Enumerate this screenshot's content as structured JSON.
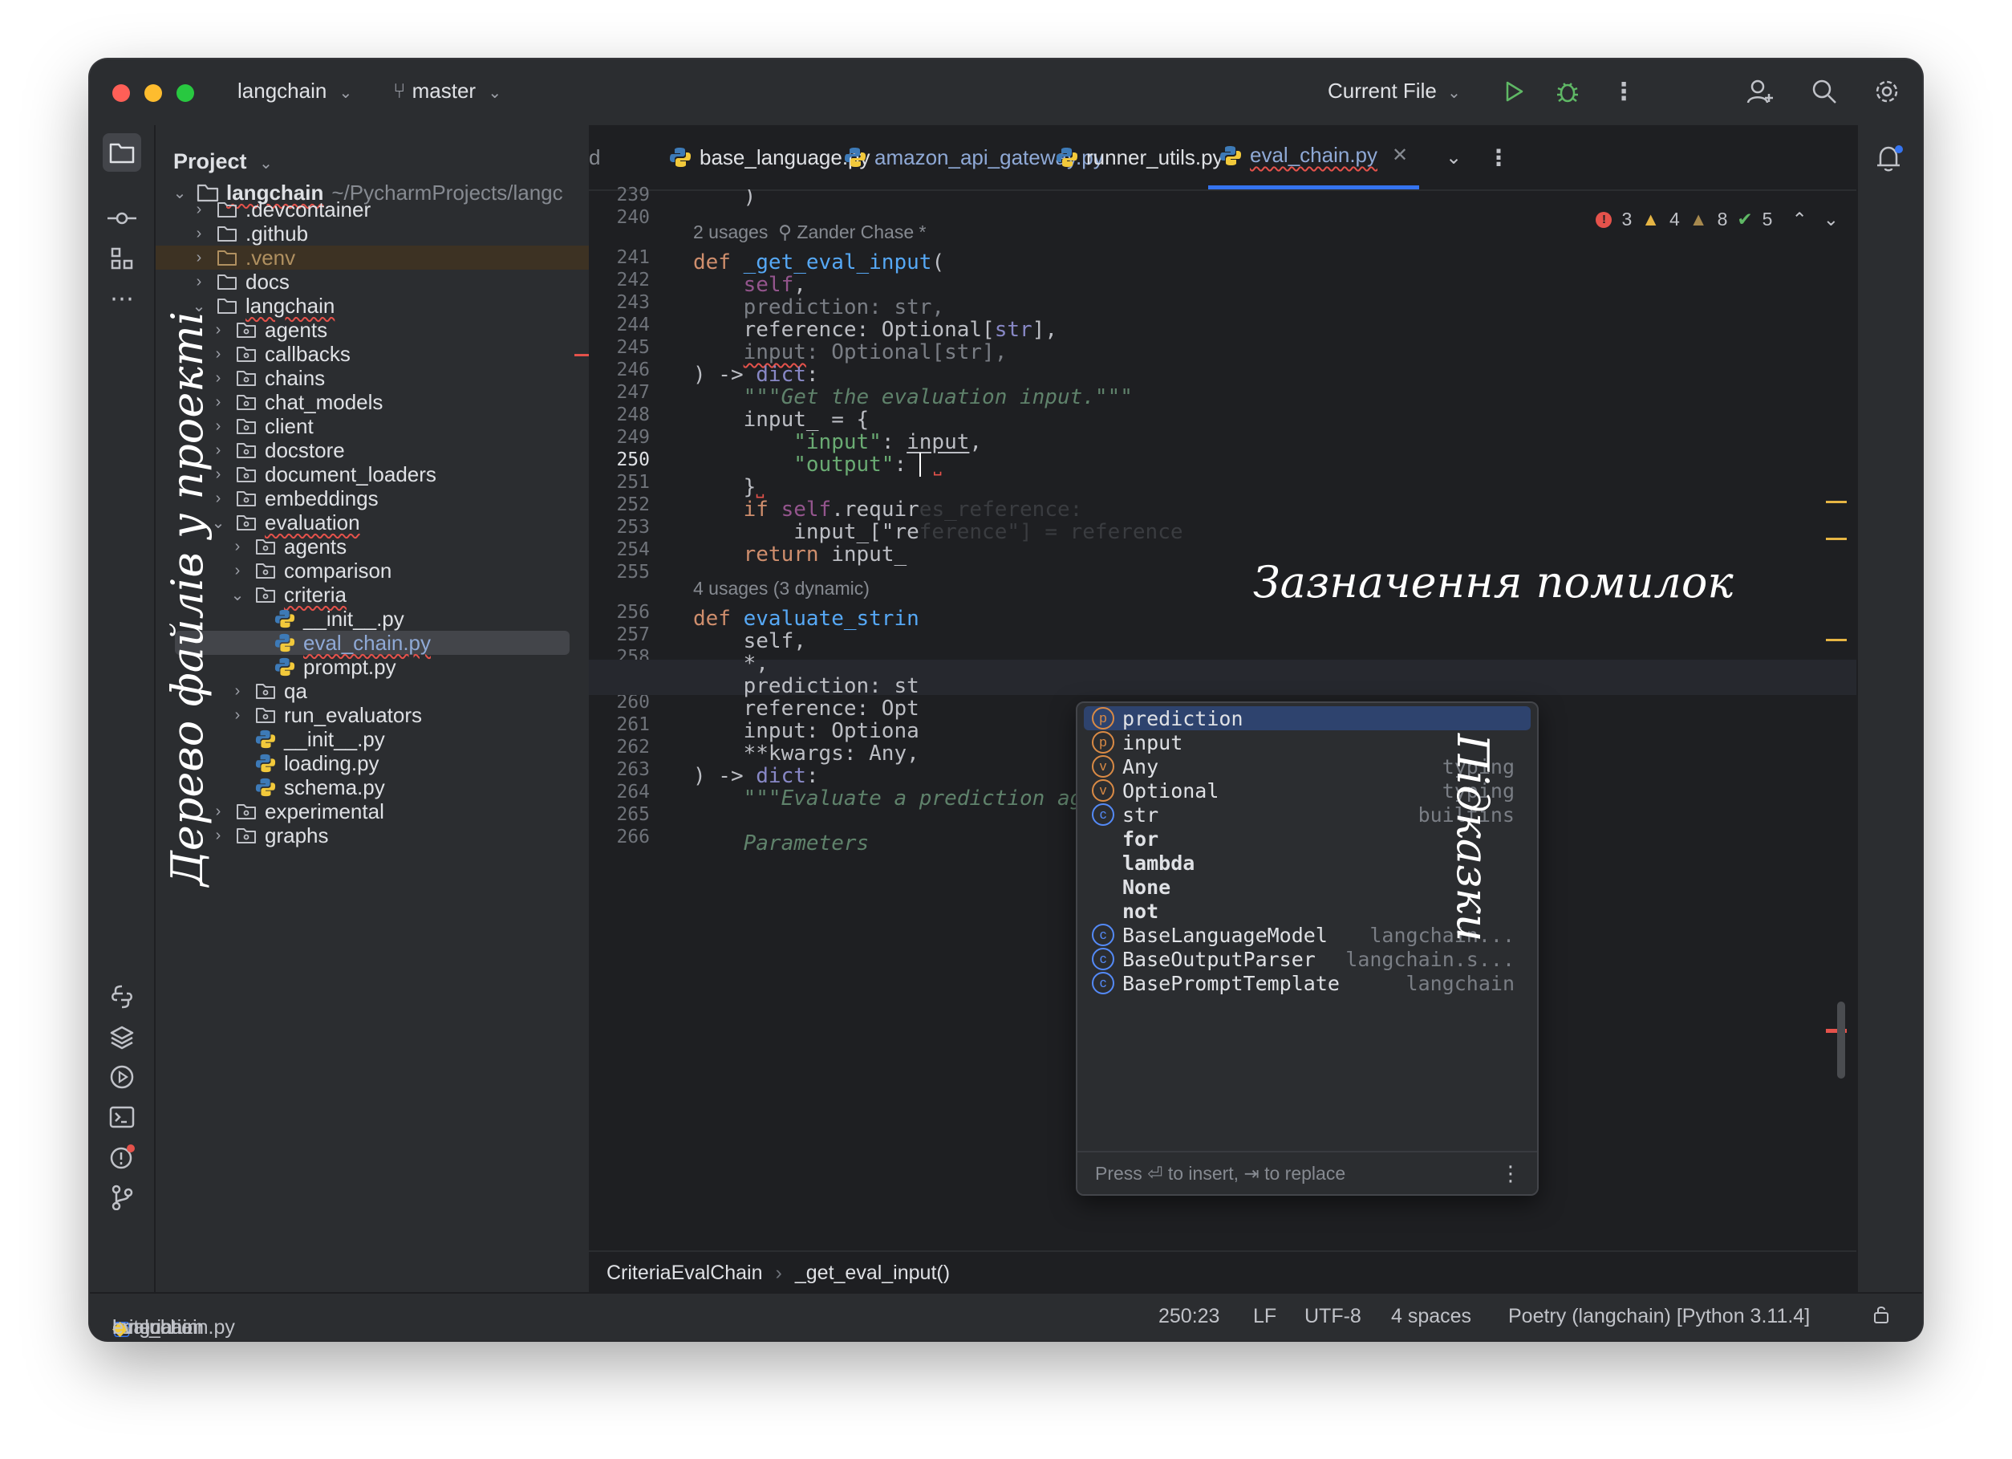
{
  "titlebar": {
    "project": "langchain",
    "branch": "master",
    "run_config": "Current File"
  },
  "project_panel": {
    "title": "Project",
    "root": {
      "name": "langchain",
      "path": "~/PycharmProjects/langc"
    },
    "items": [
      {
        "label": ".devcontainer"
      },
      {
        "label": ".github"
      },
      {
        "label": ".venv"
      },
      {
        "label": "docs"
      },
      {
        "label": "langchain"
      },
      {
        "label": "agents"
      },
      {
        "label": "callbacks"
      },
      {
        "label": "chains"
      },
      {
        "label": "chat_models"
      },
      {
        "label": "client"
      },
      {
        "label": "docstore"
      },
      {
        "label": "document_loaders"
      },
      {
        "label": "embeddings"
      },
      {
        "label": "evaluation"
      },
      {
        "label": "agents"
      },
      {
        "label": "comparison"
      },
      {
        "label": "criteria"
      },
      {
        "label": "__init__.py"
      },
      {
        "label": "eval_chain.py"
      },
      {
        "label": "prompt.py"
      },
      {
        "label": "qa"
      },
      {
        "label": "run_evaluators"
      },
      {
        "label": "__init__.py"
      },
      {
        "label": "loading.py"
      },
      {
        "label": "schema.py"
      },
      {
        "label": "experimental"
      },
      {
        "label": "graphs"
      }
    ]
  },
  "tabs": [
    {
      "label": "d"
    },
    {
      "label": "base_language.py"
    },
    {
      "label": "amazon_api_gateway.py"
    },
    {
      "label": "runner_utils.py"
    },
    {
      "label": "eval_chain.py"
    }
  ],
  "inspections": {
    "errors": "3",
    "warnings": "4",
    "weak": "8",
    "ok": "5"
  },
  "line_numbers": [
    "239",
    "240",
    "241",
    "242",
    "243",
    "244",
    "245",
    "246",
    "247",
    "248",
    "249",
    "250",
    "251",
    "252",
    "253",
    "254",
    "255",
    "256",
    "257",
    "258",
    "259",
    "260",
    "261",
    "262",
    "263",
    "264",
    "265",
    "266"
  ],
  "inlay": {
    "usages1": "2 usages",
    "author1": "Zander Chase *",
    "usages2": "4 usages (3 dynamic)"
  },
  "code": {
    "l239": "    )",
    "def1": "def",
    "fn1": "_get_eval_input",
    "paren": "(",
    "self": "self",
    "comma": ",",
    "l243": "prediction: str,",
    "l244a": "reference: Optional[",
    "l244b": "str",
    "l244c": "],",
    "l245a": "input",
    "l245b": ": Optional[str],",
    "l246a": ") -> ",
    "l246b": "dict",
    "l246c": ":",
    "l247": "\"\"\"Get the evaluation input.\"\"\"",
    "l248": "input_ = {",
    "l249a": "\"input\"",
    "l249b": ": ",
    "l249c": "input",
    "l249d": ",",
    "l250a": "\"output\"",
    "l250b": ": ",
    "l251": "}",
    "l252a": "if ",
    "l252b": "self",
    "l252c": ".requir",
    "l252ghost": "es_reference:",
    "l253a": "input_[\"re",
    "l253ghost": "ference\"] = reference",
    "l254a": "return ",
    "l254b": "input_",
    "fn2": "evaluate_strin",
    "l257": "self,",
    "l258": "*,",
    "l259": "prediction: st",
    "l260": "reference: Opt",
    "l261": "input: Optiona",
    "l262": "**kwargs: Any,",
    "l263b": "dict",
    "l264": "\"\"\"Evaluate a prediction against the criteria.",
    "l266": "Parameters"
  },
  "completion": {
    "items": [
      {
        "icon": "p",
        "label": "prediction",
        "source": ""
      },
      {
        "icon": "p",
        "label": "input",
        "source": ""
      },
      {
        "icon": "v",
        "label": "Any",
        "source": "typing"
      },
      {
        "icon": "v",
        "label": "Optional",
        "source": "typing"
      },
      {
        "icon": "c",
        "label": "str",
        "source": "builtins"
      },
      {
        "icon": "",
        "label": "for",
        "source": ""
      },
      {
        "icon": "",
        "label": "lambda",
        "source": ""
      },
      {
        "icon": "",
        "label": "None",
        "source": ""
      },
      {
        "icon": "",
        "label": "not",
        "source": ""
      },
      {
        "icon": "c",
        "label": "BaseLanguageModel",
        "source": "langchain..."
      },
      {
        "icon": "c",
        "label": "BaseOutputParser",
        "source": "langchain.s..."
      },
      {
        "icon": "c",
        "label": "BasePromptTemplate",
        "source": "langchain"
      }
    ],
    "footer": "Press ⏎ to insert, ⇥ to replace"
  },
  "breadcrumb_code": {
    "class": "CriteriaEvalChain",
    "method": "_get_eval_input()"
  },
  "statusbar": {
    "path": [
      "langchain",
      "langchain",
      "evaluation",
      "criteria",
      "eval_chain.py"
    ],
    "position": "250:23",
    "line_sep": "LF",
    "encoding": "UTF-8",
    "indent": "4 spaces",
    "interpreter": "Poetry (langchain) [Python 3.11.4]"
  },
  "annotations": {
    "tree": "Дерево файлів у проекті",
    "errors": "Зазначення помилок",
    "hints": "Підказки"
  },
  "colors": {
    "bg": "#1e1f22",
    "panel": "#2b2d30",
    "accent": "#3574f0",
    "keyword": "#cf8e6d",
    "function": "#56a8f5",
    "string": "#6aab73",
    "error": "#e5524b",
    "warning": "#e6b544"
  }
}
